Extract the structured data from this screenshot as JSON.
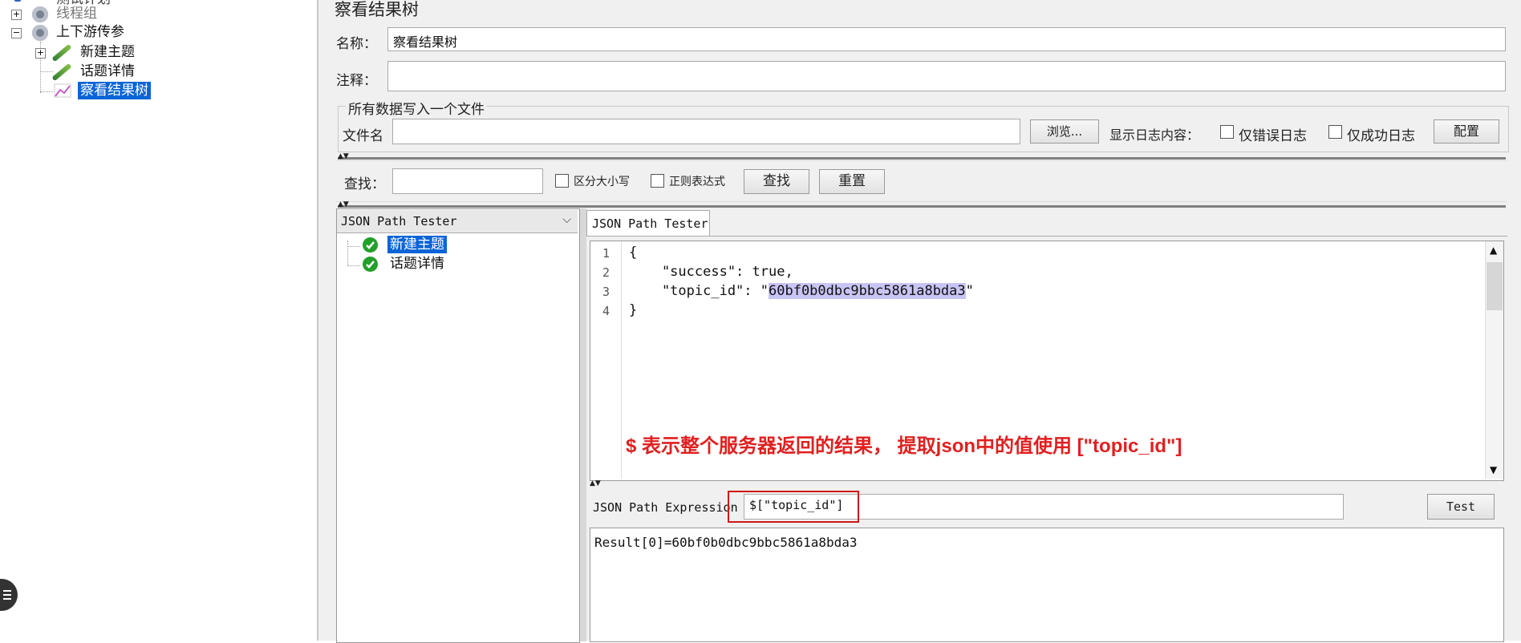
{
  "tree": {
    "top_partial": "测试计划",
    "thread_group": "线程组",
    "param_group": "上下游传参",
    "children": [
      "新建主题",
      "话题详情",
      "察看结果树"
    ]
  },
  "panel": {
    "title": "察看结果树",
    "name_label": "名称：",
    "name_value": "察看结果树",
    "comment_label": "注释：",
    "comment_value": "",
    "file_group_title": "所有数据写入一个文件",
    "filename_label": "文件名",
    "filename_value": "",
    "browse_button": "浏览...",
    "log_content_label": "显示日志内容：",
    "errors_only": "仅错误日志",
    "success_only": "仅成功日志",
    "config_button": "配置"
  },
  "search": {
    "label": "查找：",
    "value": "",
    "case_sensitive": "区分大小写",
    "regex": "正则表达式",
    "find_button": "查找",
    "reset_button": "重置"
  },
  "results": {
    "renderer_select": "JSON Path Tester",
    "samples": [
      "新建主题",
      "话题详情"
    ],
    "tab_label": "JSON Path Tester",
    "code_lines": [
      {
        "num": "1",
        "text": "{"
      },
      {
        "num": "2",
        "text": "    \"success\": true,"
      },
      {
        "num": "3",
        "text": "    \"topic_id\": \"",
        "highlight": "60bf0b0dbc9bbc5861a8bda3",
        "after": "\""
      },
      {
        "num": "4",
        "text": "}"
      }
    ],
    "annotation": "$ 表示整个服务器返回的结果， 提取json中的值使用 [\"topic_id\"]",
    "expression_label": "JSON Path Expression",
    "expression_value": "$[\"topic_id\"]",
    "test_button": "Test",
    "result_text": "Result[0]=60bf0b0dbc9bbc5861a8bda3"
  },
  "colors": {
    "selection": "#0a64d8",
    "annotation_red": "#e02020",
    "highlight": "#c8c4f4",
    "panel_bg": "#f0f0f0"
  },
  "icons": [
    "gear-icon",
    "pipette-icon",
    "tree-icon",
    "success-shield-icon",
    "chevron-down-icon",
    "menu-icon"
  ]
}
